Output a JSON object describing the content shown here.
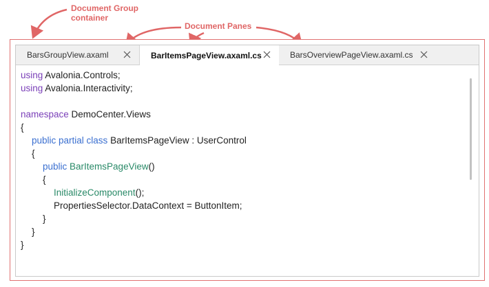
{
  "callouts": {
    "group_line1": "Document Group",
    "group_line2": "container",
    "panes": "Document Panes"
  },
  "tabs": [
    {
      "label": "BarsGroupView.axaml",
      "active": false
    },
    {
      "label": "BarItemsPageView.axaml.cs",
      "active": true
    },
    {
      "label": "BarsOverviewPageView.axaml.cs",
      "active": false
    }
  ],
  "code": {
    "l1_kw": "using",
    "l1_rest": " Avalonia.Controls;",
    "l2_kw": "using",
    "l2_rest": " Avalonia.Interactivity;",
    "l4_kw": "namespace",
    "l4_rest": " DemoCenter.Views",
    "l5": "{",
    "l6_kw": "public partial class",
    "l6_rest": " BarItemsPageView : UserControl",
    "l7": "{",
    "l8_kw": "public",
    "l8_fn": " BarItemsPageView",
    "l8_rest": "()",
    "l9": "{",
    "l10_fn": "InitializeComponent",
    "l10_rest": "();",
    "l11": "PropertiesSelector.DataContext = ButtonItem;",
    "l12": "}",
    "l13": "}",
    "l14": "}"
  },
  "colors": {
    "callout": "#e06666",
    "keyword": "#7a3fb8",
    "keyword_blue": "#3a6fd0",
    "method": "#2a8a68"
  },
  "icons": {
    "tab_close": "close-icon"
  }
}
